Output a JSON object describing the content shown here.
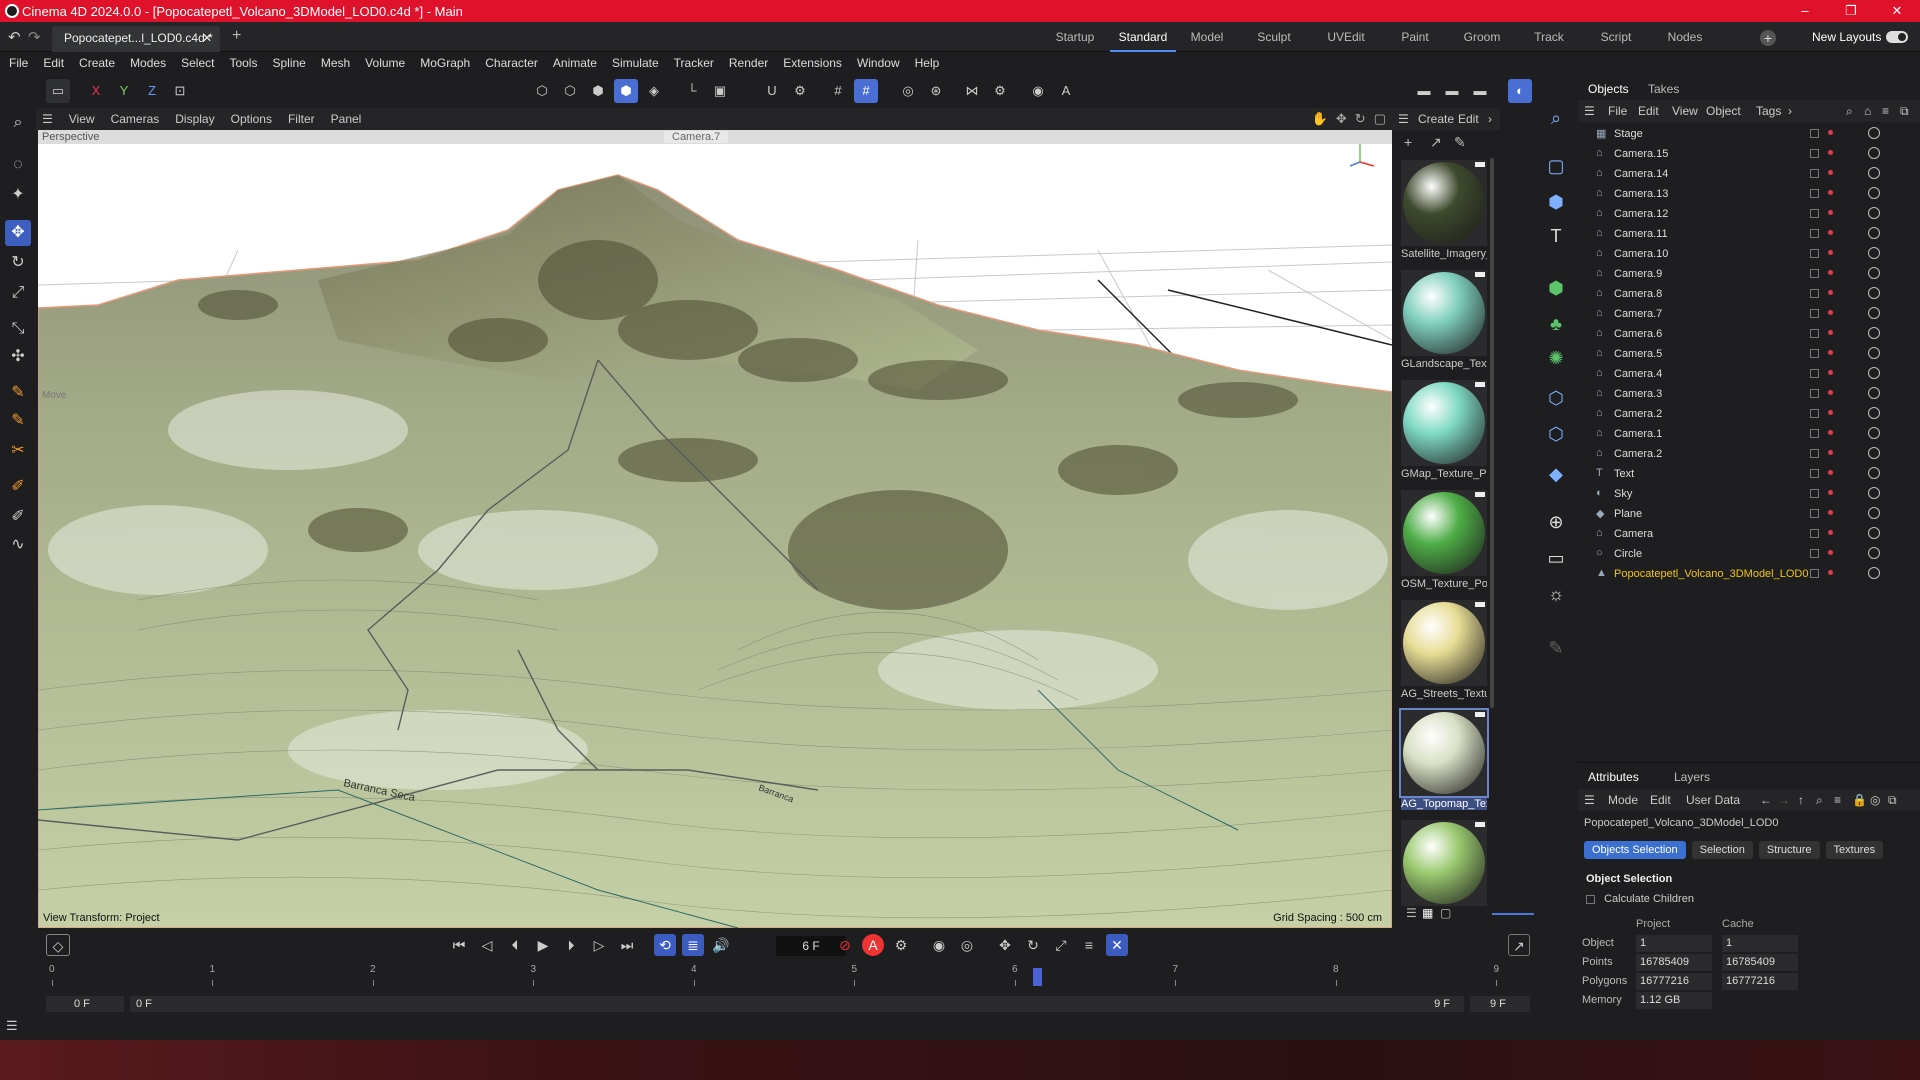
{
  "window": {
    "title": "Cinema 4D 2024.0.0 - [Popocatepetl_Volcano_3DModel_LOD0.c4d *] - Main",
    "min": "–",
    "max": "❐",
    "close": "✕"
  },
  "tab": {
    "label": "Popocatepet...l_LOD0.c4d *",
    "close": "✕",
    "add": "+"
  },
  "layouts": [
    "Startup",
    "Standard",
    "Model",
    "Sculpt",
    "UVEdit",
    "Paint",
    "Groom",
    "Track",
    "Script",
    "Nodes"
  ],
  "active_layout": "Standard",
  "new_layouts": "New Layouts",
  "menu": [
    "File",
    "Edit",
    "Create",
    "Modes",
    "Select",
    "Tools",
    "Spline",
    "Mesh",
    "Volume",
    "MoGraph",
    "Character",
    "Animate",
    "Simulate",
    "Tracker",
    "Render",
    "Extensions",
    "Window",
    "Help"
  ],
  "axis_buttons": [
    "X",
    "Y",
    "Z"
  ],
  "viewport": {
    "menu": [
      "View",
      "Cameras",
      "Display",
      "Options",
      "Filter",
      "Panel"
    ],
    "label": "Perspective",
    "camera": "Camera.7",
    "move_label": "Move",
    "bottom_left": "View Transform: Project",
    "bottom_right": "Grid Spacing : 500 cm",
    "map_labels": [
      "Barranca Seca",
      "Barranca"
    ]
  },
  "materials": {
    "menu": [
      "Create",
      "Edit"
    ],
    "items": [
      {
        "name": "Satellite_Imagery_",
        "color": "#3e4a2c"
      },
      {
        "name": "GLandscape_Textu",
        "color": "#7fcfbd"
      },
      {
        "name": "GMap_Texture_Po",
        "color": "#7ed9c3"
      },
      {
        "name": "OSM_Texture_Pop",
        "color": "#4fae47"
      },
      {
        "name": "AG_Streets_Textur",
        "color": "#e7dc94"
      },
      {
        "name": "AG_Topomap_Tex",
        "color": "#d9e0c4"
      },
      {
        "name": "",
        "color": "#9ac96f"
      }
    ]
  },
  "objects": {
    "tabs": [
      "Objects",
      "Takes"
    ],
    "menu": [
      "File",
      "Edit",
      "View",
      "Object",
      "Tags"
    ],
    "items": [
      {
        "name": "Stage",
        "icon": "▦"
      },
      {
        "name": "Camera.15",
        "icon": "⌂"
      },
      {
        "name": "Camera.14",
        "icon": "⌂"
      },
      {
        "name": "Camera.13",
        "icon": "⌂"
      },
      {
        "name": "Camera.12",
        "icon": "⌂"
      },
      {
        "name": "Camera.11",
        "icon": "⌂"
      },
      {
        "name": "Camera.10",
        "icon": "⌂"
      },
      {
        "name": "Camera.9",
        "icon": "⌂"
      },
      {
        "name": "Camera.8",
        "icon": "⌂"
      },
      {
        "name": "Camera.7",
        "icon": "⌂"
      },
      {
        "name": "Camera.6",
        "icon": "⌂"
      },
      {
        "name": "Camera.5",
        "icon": "⌂"
      },
      {
        "name": "Camera.4",
        "icon": "⌂"
      },
      {
        "name": "Camera.3",
        "icon": "⌂"
      },
      {
        "name": "Camera.2",
        "icon": "⌂"
      },
      {
        "name": "Camera.1",
        "icon": "⌂"
      },
      {
        "name": "Camera.2",
        "icon": "⌂"
      },
      {
        "name": "Text",
        "icon": "T"
      },
      {
        "name": "Sky",
        "icon": "◐"
      },
      {
        "name": "Plane",
        "icon": "◆"
      },
      {
        "name": "Camera",
        "icon": "⌂"
      },
      {
        "name": "Circle",
        "icon": "○"
      },
      {
        "name": "Popocatepetl_Volcano_3DModel_LOD0",
        "icon": "▲"
      }
    ]
  },
  "attributes": {
    "tabs": [
      "Attributes",
      "Layers"
    ],
    "menu": [
      "Mode",
      "Edit",
      "User Data"
    ],
    "object_name": "Popocatepetl_Volcano_3DModel_LOD0",
    "buttons": [
      "Objects Selection",
      "Selection",
      "Structure",
      "Textures"
    ],
    "section": "Object Selection",
    "calc_children": "Calculate Children",
    "headers": [
      "Project",
      "Cache"
    ],
    "rows": [
      {
        "k": "Object",
        "project": "1",
        "cache": "1"
      },
      {
        "k": "Points",
        "project": "16785409",
        "cache": "16785409"
      },
      {
        "k": "Polygons",
        "project": "16777216",
        "cache": "16777216"
      },
      {
        "k": "Memory",
        "project": "1.12 GB",
        "cache": ""
      }
    ]
  },
  "timeline": {
    "frame": "6 F",
    "ticks": [
      "0",
      "1",
      "2",
      "3",
      "4",
      "5",
      "6",
      "7",
      "8",
      "9"
    ],
    "start": "0 F",
    "min": "0 F",
    "max": "9 F",
    "end": "9 F"
  },
  "colors": {
    "titlebar": "#e0112a",
    "accent": "#4a6fd4",
    "selection_text": "#f0c419"
  }
}
